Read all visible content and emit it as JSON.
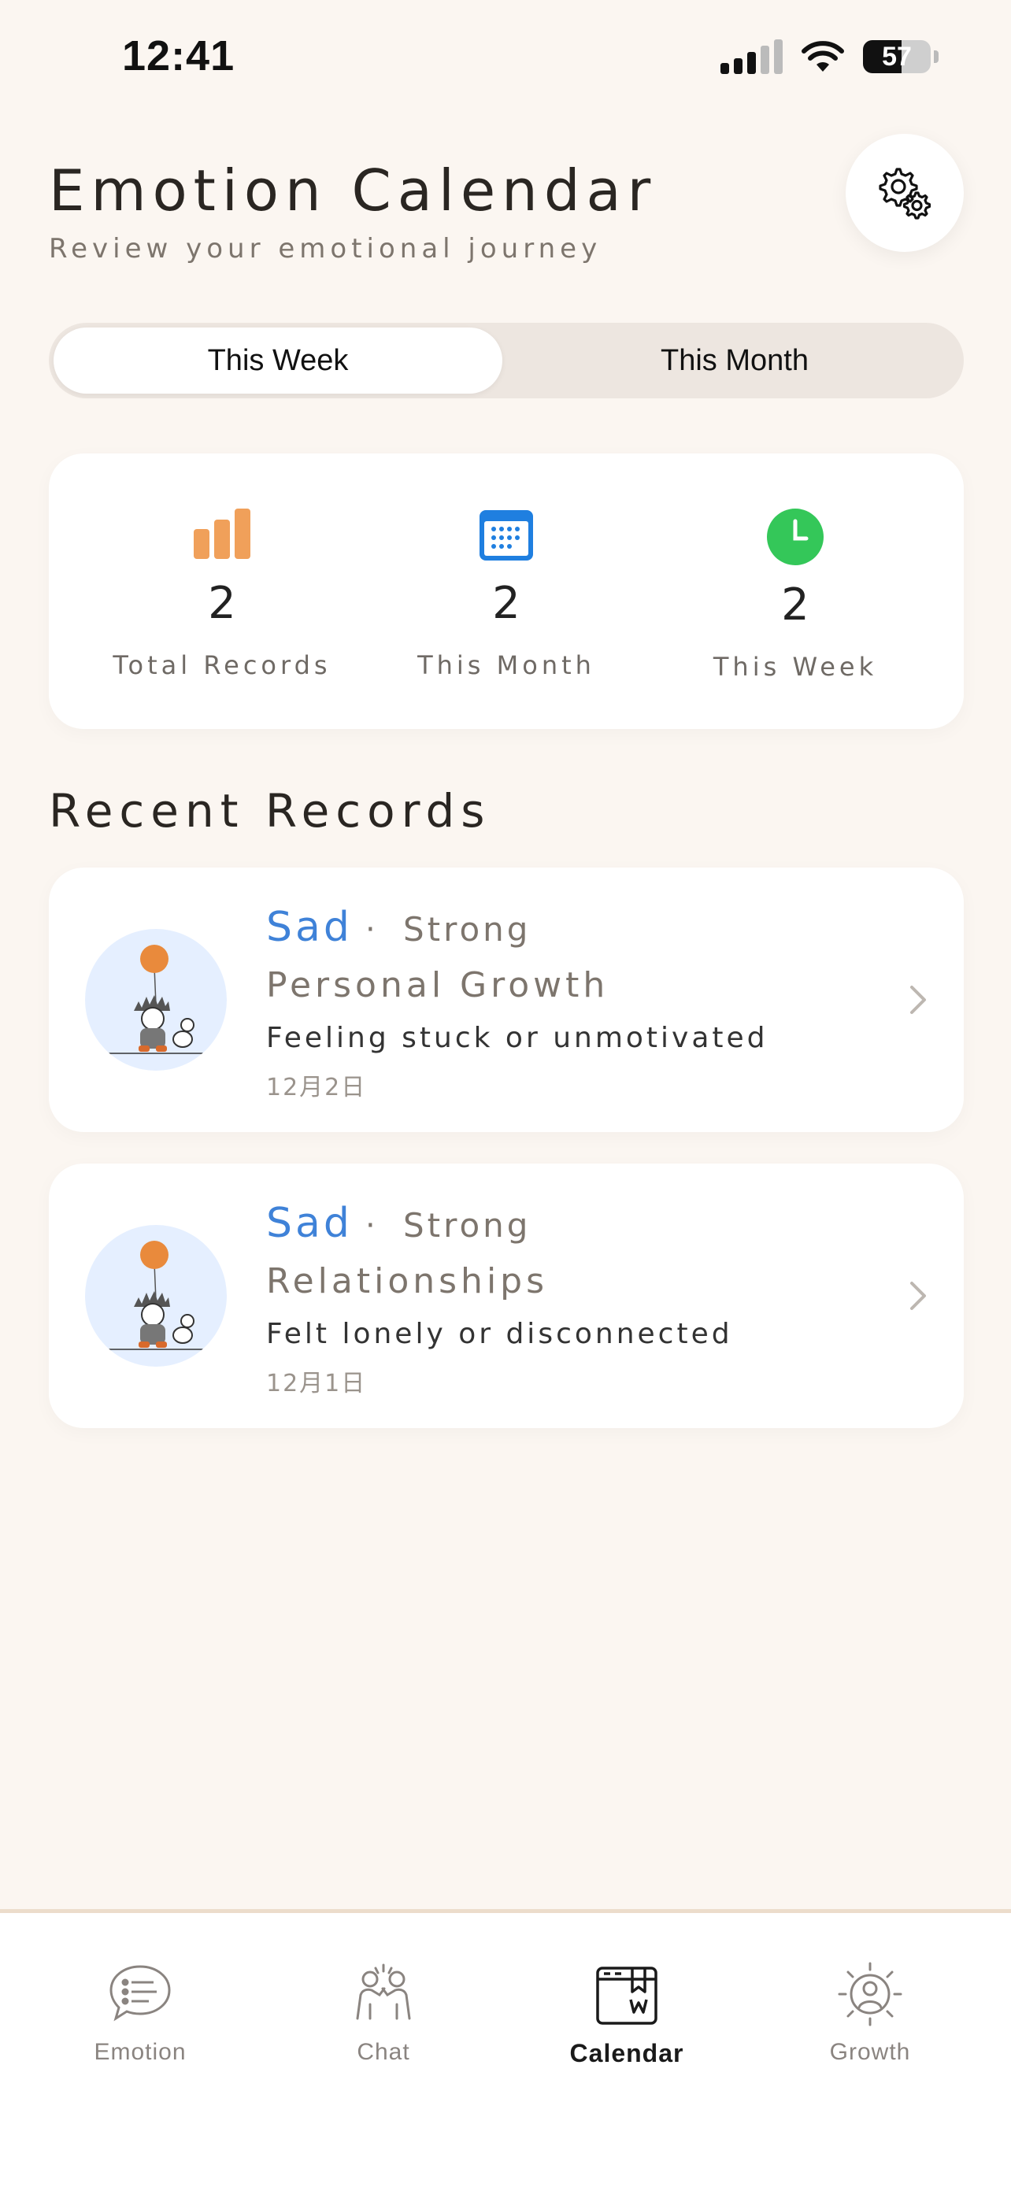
{
  "status_bar": {
    "time": "12:41",
    "battery_level": "57",
    "battery_fraction": 0.57
  },
  "header": {
    "title": "Emotion Calendar",
    "subtitle": "Review your emotional journey",
    "settings_icon": "gears-icon"
  },
  "segmented": {
    "options": [
      "This Week",
      "This Month"
    ],
    "selected": "This Week"
  },
  "stats": [
    {
      "value": "2",
      "label": "Total Records",
      "icon": "bar-chart-icon",
      "color": "#f0a05a"
    },
    {
      "value": "2",
      "label": "This Month",
      "icon": "calendar-icon",
      "color": "#1f7fe0"
    },
    {
      "value": "2",
      "label": "This Week",
      "icon": "clock-icon",
      "color": "#34c759"
    }
  ],
  "recent": {
    "title": "Recent Records",
    "items": [
      {
        "emotion": "Sad",
        "separator": "·",
        "intensity": "Strong",
        "category": "Personal Growth",
        "note": "Feeling stuck or unmotivated",
        "date": "12月2日"
      },
      {
        "emotion": "Sad",
        "separator": "·",
        "intensity": "Strong",
        "category": "Relationships",
        "note": "Felt lonely or disconnected",
        "date": "12月1日"
      }
    ]
  },
  "tabbar": {
    "items": [
      {
        "label": "Emotion",
        "icon": "chat-bubble-icon"
      },
      {
        "label": "Chat",
        "icon": "people-icon"
      },
      {
        "label": "Calendar",
        "icon": "journal-icon"
      },
      {
        "label": "Growth",
        "icon": "sun-person-icon"
      }
    ],
    "active": "Calendar"
  },
  "colors": {
    "background": "#fbf6f1",
    "accent_blue": "#3f82d8",
    "bar_orange": "#f0a05a",
    "calendar_blue": "#1f7fe0",
    "clock_green": "#34c759"
  }
}
